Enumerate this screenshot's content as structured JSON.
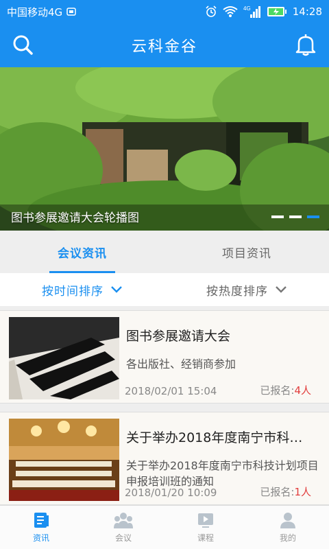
{
  "status_bar": {
    "carrier": "中国移动4G",
    "network": "4G",
    "time": "14:28"
  },
  "header": {
    "title": "云科金谷",
    "left_icon": "search-icon",
    "right_icon": "bell-icon"
  },
  "banner": {
    "caption": "图书参展邀请大会轮播图",
    "slide_count": 3,
    "active_slide": 3
  },
  "tabs": [
    {
      "label": "会议资讯",
      "active": true
    },
    {
      "label": "项目资讯",
      "active": false
    }
  ],
  "sort": [
    {
      "label": "按时间排序",
      "active": true
    },
    {
      "label": "按热度排序",
      "active": false
    }
  ],
  "items": [
    {
      "title": "图书参展邀请大会",
      "desc": "各出版社、经销商参加",
      "date": "2018/02/01 15:04",
      "signup_label": "已报名:",
      "signup_count": "4人"
    },
    {
      "title": "关于举办2018年度南宁市科…",
      "desc": "关于举办2018年度南宁市科技计划项目申报培训班的通知",
      "date": "2018/01/20 10:09",
      "signup_label": "已报名:",
      "signup_count": "1人"
    }
  ],
  "bottom_nav": [
    {
      "label": "资讯",
      "icon": "news-icon",
      "active": true
    },
    {
      "label": "会议",
      "icon": "meeting-icon",
      "active": false
    },
    {
      "label": "课程",
      "icon": "course-icon",
      "active": false
    },
    {
      "label": "我的",
      "icon": "profile-icon",
      "active": false
    }
  ],
  "colors": {
    "primary": "#1a8ff0",
    "accent_red": "#e23c3c"
  }
}
